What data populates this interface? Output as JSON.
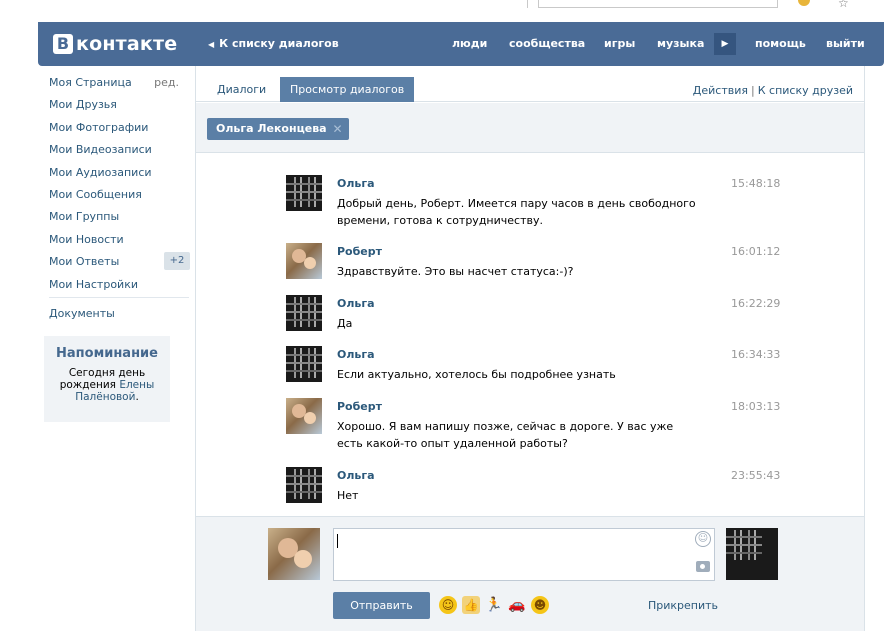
{
  "header": {
    "logo_letter": "В",
    "logo_text": "контакте",
    "back_link": "К списку диалогов",
    "links": [
      "люди",
      "сообщества",
      "игры",
      "музыка",
      "помощь",
      "выйти"
    ]
  },
  "leftnav": {
    "items": [
      {
        "label": "Моя Страница",
        "extra": "ред."
      },
      {
        "label": "Мои Друзья"
      },
      {
        "label": "Мои Фотографии"
      },
      {
        "label": "Мои Видеозаписи"
      },
      {
        "label": "Мои Аудиозаписи"
      },
      {
        "label": "Мои Сообщения"
      },
      {
        "label": "Мои Группы"
      },
      {
        "label": "Мои Новости"
      },
      {
        "label": "Мои Ответы",
        "badge": "+2"
      },
      {
        "label": "Мои Настройки"
      }
    ],
    "documents": "Документы"
  },
  "reminder": {
    "title": "Напоминание",
    "text_1": "Сегодня день",
    "text_2": "рождения",
    "name_1": "Елены",
    "name_2": "Палёновой",
    "period": "."
  },
  "tabs": {
    "dialogs": "Диалоги",
    "view": "Просмотр диалогов",
    "actions": "Действия",
    "separator": "|",
    "to_friends": "К списку друзей"
  },
  "filter": {
    "chip_label": "Ольга Леконцева",
    "chip_close": "✕"
  },
  "messages": [
    {
      "author": "Ольга",
      "avatar": "dark",
      "time": "15:48:18",
      "text": "Добрый день, Роберт. Имеется пару часов в день свободного времени, готова к сотрудничеству."
    },
    {
      "author": "Роберт",
      "avatar": "photo",
      "time": "16:01:12",
      "text": "Здравствуйте. Это вы насчет статуса:-)?"
    },
    {
      "author": "Ольга",
      "avatar": "dark",
      "time": "16:22:29",
      "text": "Да"
    },
    {
      "author": "Ольга",
      "avatar": "dark",
      "time": "16:34:33",
      "text": "Если актуально, хотелось бы подробнее узнать"
    },
    {
      "author": "Роберт",
      "avatar": "photo",
      "time": "18:03:13",
      "text": "Хорошо. Я вам напишу позже, сейчас в дороге. У вас уже есть какой-то опыт удаленной работы?"
    },
    {
      "author": "Ольга",
      "avatar": "dark",
      "time": "23:55:43",
      "text": "Нет"
    }
  ],
  "composer": {
    "input_value": "",
    "send_label": "Отправить",
    "attach_label": "Прикрепить",
    "emojis": [
      "smile-emoji",
      "thumbs-up-emoji",
      "running-man-emoji",
      "car-emoji",
      "grin-emoji"
    ]
  },
  "colors": {
    "header_bg": "#4a6b96",
    "link": "#2b587a",
    "accent": "#5b7fa6",
    "panel_bg": "#f0f3f6"
  }
}
